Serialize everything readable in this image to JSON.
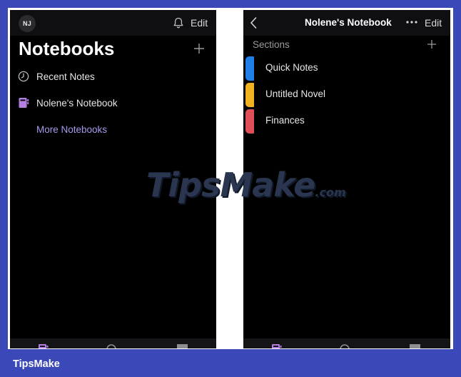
{
  "left_screen": {
    "avatar_initials": "NJ",
    "edit_label": "Edit",
    "title": "Notebooks",
    "nav_items": [
      {
        "label": "Recent Notes",
        "icon": "clock-icon"
      },
      {
        "label": "Nolene's Notebook",
        "icon": "notebook-icon",
        "icon_color": "#b57fe0"
      }
    ],
    "more_notebooks_label": "More Notebooks",
    "link_color": "#a49bee",
    "bottom_tabs": [
      "notebooks-tab-icon",
      "search-tab-icon",
      "sticky-notes-tab-icon"
    ]
  },
  "right_screen": {
    "title": "Nolene's Notebook",
    "edit_label": "Edit",
    "sections_label": "Sections",
    "sections": [
      {
        "label": "Quick Notes",
        "color": "#1f7fe6"
      },
      {
        "label": "Untitled Novel",
        "color": "#f2b21f"
      },
      {
        "label": "Finances",
        "color": "#e04f58"
      }
    ],
    "bottom_tabs": [
      "notebooks-tab-icon",
      "search-tab-icon",
      "sticky-notes-tab-icon"
    ]
  },
  "watermark": {
    "main": "TipsMake",
    "suffix": ".com"
  },
  "brand_label": "TipsMake",
  "colors": {
    "frame_blue": "#3b48b8",
    "background": "#000000"
  }
}
